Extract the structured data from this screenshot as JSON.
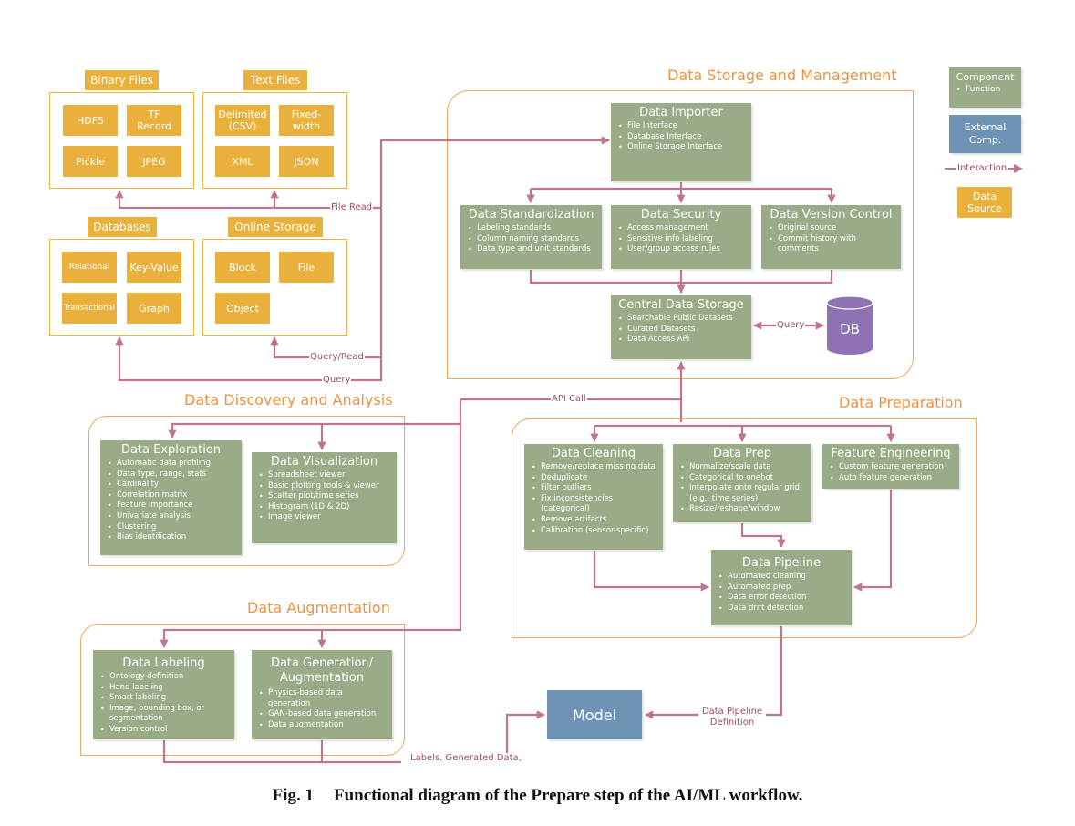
{
  "colors": {
    "component": "#9aab87",
    "external": "#6f93b7",
    "data_source": "#e9b03b",
    "interaction": "#bf7590",
    "group_border": "#f4a55a",
    "group_title": "#f0923e",
    "db": "#8e72b3"
  },
  "data_sources": {
    "binary_files": {
      "title": "Binary Files",
      "items": [
        "HDF5",
        "TF Record",
        "Pickle",
        "JPEG"
      ]
    },
    "text_files": {
      "title": "Text Files",
      "items": [
        "Delimited (CSV)",
        "Fixed-width",
        "XML",
        "JSON"
      ]
    },
    "databases": {
      "title": "Databases",
      "items": [
        "Relational",
        "Key-Value",
        "Transactional",
        "Graph"
      ]
    },
    "online_storage": {
      "title": "Online Storage",
      "items": [
        "Block",
        "File",
        "Object"
      ]
    }
  },
  "groups": {
    "storage": "Data Storage and Management",
    "discovery": "Data Discovery and Analysis",
    "preparation": "Data Preparation",
    "augmentation": "Data Augmentation"
  },
  "components": {
    "importer": {
      "title": "Data Importer",
      "items": [
        "File Interface",
        "Database Interface",
        "Online Storage Interface"
      ]
    },
    "standardization": {
      "title": "Data Standardization",
      "items": [
        "Labeling standards",
        "Column naming standards",
        "Data type and unit standards"
      ]
    },
    "security": {
      "title": "Data Security",
      "items": [
        "Access management",
        "Sensitive info labeling",
        "User/group access rules"
      ]
    },
    "version": {
      "title": "Data Version Control",
      "items": [
        "Original source",
        "Commit history with comments"
      ]
    },
    "central": {
      "title": "Central Data Storage",
      "items": [
        "Searchable Public Datasets",
        "Curated Datasets",
        "Data Access API"
      ]
    },
    "exploration": {
      "title": "Data Exploration",
      "items": [
        "Automatic data profiling",
        "Data type, range, stats",
        "Cardinality",
        "Correlation matrix",
        "Feature importance",
        "Univariate analysis",
        "Clustering",
        "Bias identification"
      ]
    },
    "visualization": {
      "title": "Data Visualization",
      "items": [
        "Spreadsheet viewer",
        "Basic plotting tools & viewer",
        "Scatter plot/time series",
        "Histogram (1D & 2D)",
        "Image viewer"
      ]
    },
    "cleaning": {
      "title": "Data Cleaning",
      "items": [
        "Remove/replace missing data",
        "Deduplicate",
        "Filter outliers",
        "Fix inconsistencies (categorical)",
        "Remove artifacts",
        "Calibration (sensor-specific)"
      ]
    },
    "prep": {
      "title": "Data Prep",
      "items": [
        "Normalize/scale data",
        "Categorical to onehot",
        "Interpolate onto regular grid (e.g., time series)",
        "Resize/reshape/window"
      ]
    },
    "feature": {
      "title": "Feature Engineering",
      "items": [
        "Custom feature generation",
        "Auto feature generation"
      ]
    },
    "pipeline": {
      "title": "Data Pipeline",
      "items": [
        "Automated cleaning",
        "Automated prep",
        "Data error detection",
        "Data drift detection"
      ]
    },
    "labeling": {
      "title": "Data Labeling",
      "items": [
        "Ontology definition",
        "Hand labeling",
        "Smart labeling",
        "Image, bounding box, or segmentation",
        "Version control"
      ]
    },
    "generation": {
      "title": "Data Generation/ Augmentation",
      "items": [
        "Physics-based data generation",
        "GAN-based data generation",
        "Data augmentation"
      ]
    }
  },
  "external": {
    "db": "DB",
    "model": "Model"
  },
  "edge_labels": {
    "file_read": "File Read",
    "query_read": "Query/Read",
    "query": "Query",
    "db_query": "Query",
    "api_call": "API Call",
    "pipeline_def": "Data Pipeline Definition",
    "labels_generated": "Labels, Generated Data,"
  },
  "legend": {
    "component": "Component",
    "function": "Function",
    "external": "External Comp.",
    "interaction": "Interaction",
    "data_source": "Data Source"
  },
  "caption": {
    "number": "Fig. 1",
    "text": "Functional diagram of the Prepare step of the AI/ML workflow."
  }
}
